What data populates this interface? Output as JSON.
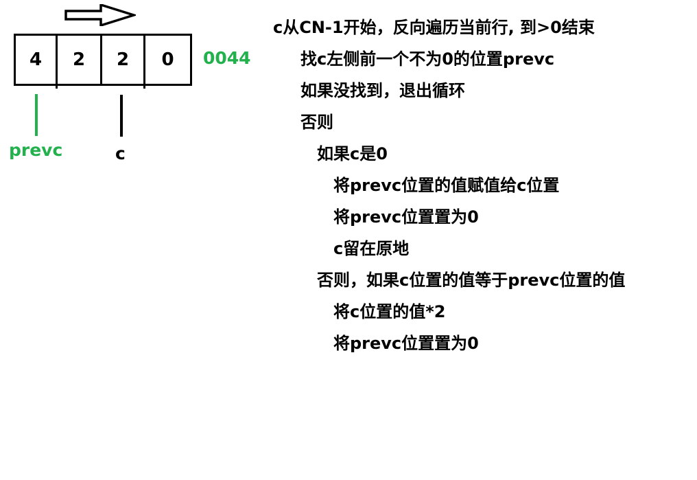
{
  "colors": {
    "accent_green": "#22b14c",
    "ink": "#000000",
    "background": "#ffffff"
  },
  "arrow": {
    "icon": "right-arrow-icon",
    "direction": "right"
  },
  "array": {
    "cells": [
      "4",
      "2",
      "2",
      "0"
    ]
  },
  "result": "0044",
  "pointers": {
    "prevc": "prevc",
    "c": "c"
  },
  "algorithm": {
    "lines": [
      {
        "text": "c从CN-1开始，反向遍历当前行, 到>0结束",
        "indent": 0
      },
      {
        "text": "找c左侧前一个不为0的位置prevc",
        "indent": 1
      },
      {
        "text": "如果没找到，退出循环",
        "indent": 1
      },
      {
        "text": "否则",
        "indent": 1
      },
      {
        "text": "如果c是0",
        "indent": 2
      },
      {
        "text": "将prevc位置的值赋值给c位置",
        "indent": 3
      },
      {
        "text": "将prevc位置置为0",
        "indent": 3
      },
      {
        "text": "c留在原地",
        "indent": 3
      },
      {
        "text": "否则，如果c位置的值等于prevc位置的值",
        "indent": 2
      },
      {
        "text": "将c位置的值*2",
        "indent": 3
      },
      {
        "text": "将prevc位置置为0",
        "indent": 3
      }
    ]
  }
}
